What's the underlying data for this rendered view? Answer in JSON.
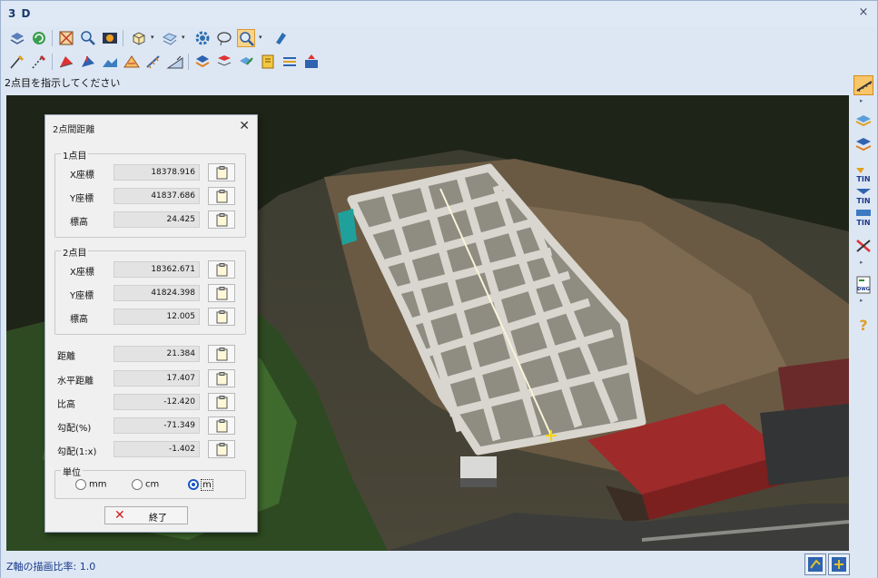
{
  "window": {
    "title": "3 D",
    "close_glyph": "×"
  },
  "prompt": "2点目を指示してください",
  "toolbar1": [
    "layers-icon",
    "refresh-icon",
    "fit-extent-icon",
    "zoom-icon",
    "camera-icon",
    "cube-view-icon",
    "section-box-icon",
    "settings-gear-icon",
    "lasso-icon",
    "measure-zoom-icon",
    "paint-icon"
  ],
  "toolbar2": [
    "pencil-line-icon",
    "pencil-dash-icon",
    "pointcloud-red-icon",
    "pointcloud-blue-icon",
    "terrain-icon",
    "contour-icon",
    "slope-icon",
    "grade-icon",
    "stack-icon",
    "filter-icon",
    "layer-edit-icon",
    "book-icon",
    "lines-icon",
    "export-icon"
  ],
  "rightbar": [
    "measure-ruler-icon",
    "section-icon",
    "terrain-layers-icon",
    "tin-create-icon",
    "tin-edit-icon",
    "tin-view-icon",
    "cut-icon",
    "dwg-icon",
    "help-icon"
  ],
  "rightbar_tin_label": "TIN",
  "rightbar_dwg_label": "DWG",
  "status": {
    "text": "Z軸の描画比率: 1.0"
  },
  "dialog": {
    "title": "2点間距離",
    "close_glyph": "✕",
    "point1": {
      "label": "1点目",
      "x_label": "X座標",
      "x_value": "18378.916",
      "y_label": "Y座標",
      "y_value": "41837.686",
      "z_label": "標高",
      "z_value": "24.425"
    },
    "point2": {
      "label": "2点目",
      "x_label": "X座標",
      "x_value": "18362.671",
      "y_label": "Y座標",
      "y_value": "41824.398",
      "z_label": "標高",
      "z_value": "12.005"
    },
    "results": {
      "distance_label": "距離",
      "distance_value": "21.384",
      "horizontal_label": "水平距離",
      "horizontal_value": "17.407",
      "height_label": "比高",
      "height_value": "-12.420",
      "slope_pct_label": "勾配(%)",
      "slope_pct_value": "-71.349",
      "slope_ratio_label": "勾配(1:x)",
      "slope_ratio_value": "-1.402"
    },
    "units": {
      "label": "単位",
      "options": [
        "mm",
        "cm",
        "m"
      ],
      "selected": "m"
    },
    "end_button": "終了"
  }
}
